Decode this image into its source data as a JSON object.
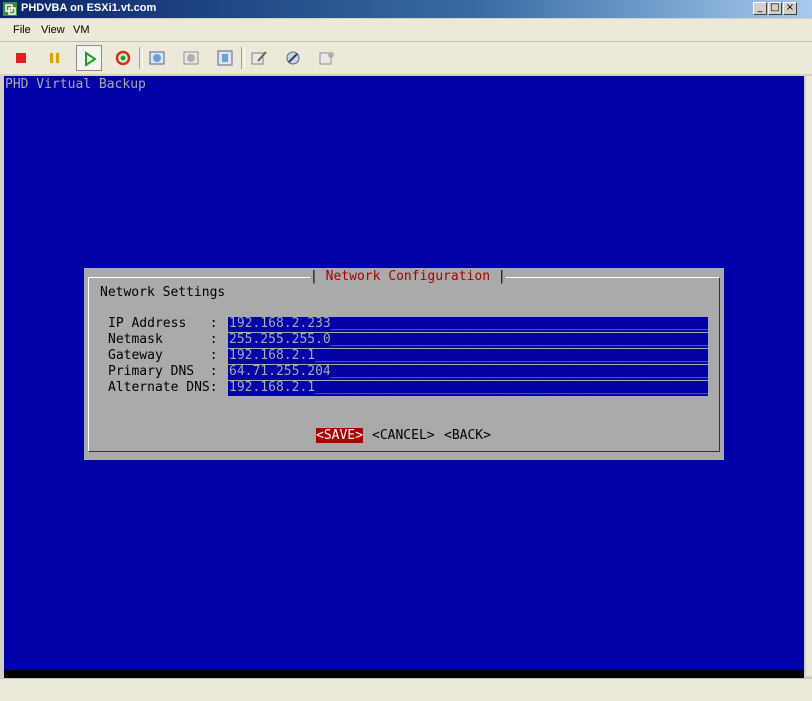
{
  "window": {
    "title": "PHDVBA on ESXi1.vt.com",
    "buttons": [
      "_",
      "□",
      "×"
    ]
  },
  "menu": [
    "File",
    "View",
    "VM"
  ],
  "toolbar": {
    "icons": [
      "power-off-icon",
      "suspend-icon",
      "power-on-icon",
      "reset-icon",
      "snapshot-icon",
      "revert-snapshot-icon",
      "snapshot-manager-icon",
      "edit-settings-icon",
      "vm-tools-icon",
      "console-options-icon"
    ],
    "colors": {
      "stop": "#e02020",
      "pause": "#e0a000",
      "play": "#20a020",
      "reset": "#d03020"
    }
  },
  "console": {
    "title": "PHD Virtual Backup",
    "bg_color": "#0000a8",
    "dialog": {
      "title": "Network Configuration",
      "heading": "Network Settings",
      "fields": [
        {
          "label": "IP Address   :",
          "value": "192.168.2.233"
        },
        {
          "label": "Netmask      :",
          "value": "255.255.255.0"
        },
        {
          "label": "Gateway      :",
          "value": "192.168.2.1"
        },
        {
          "label": "Primary DNS  :",
          "value": "64.71.255.204"
        },
        {
          "label": "Alternate DNS:",
          "value": "192.168.2.1"
        }
      ],
      "buttons": {
        "save": "<SAVE>",
        "cancel": "<CANCEL>",
        "back": "<BACK>"
      }
    }
  }
}
